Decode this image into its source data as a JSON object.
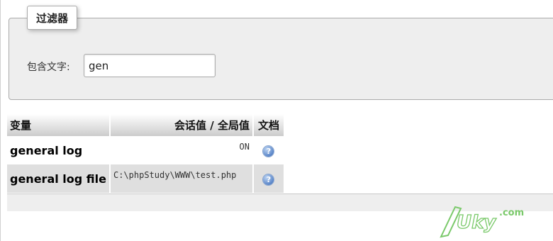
{
  "filter": {
    "legend": "过滤器",
    "label": "包含文字:",
    "value": "gen"
  },
  "table": {
    "headers": {
      "variable": "变量",
      "value": "会话值 / 全局值",
      "docs": "文档"
    },
    "rows": [
      {
        "name": "general log",
        "value": "ON",
        "doc_icon": "help-icon"
      },
      {
        "name": "general log file",
        "value": "C:\\phpStudy\\WWW\\test.php",
        "doc_icon": "help-icon"
      }
    ]
  },
  "watermark": {
    "text": "Uky",
    "suffix": ".com"
  },
  "colors": {
    "panel_bg": "#eeeeee",
    "row_alt_bg": "#dfdfdf",
    "help_icon": "#5b86c9",
    "watermark": "#7ac96a"
  }
}
